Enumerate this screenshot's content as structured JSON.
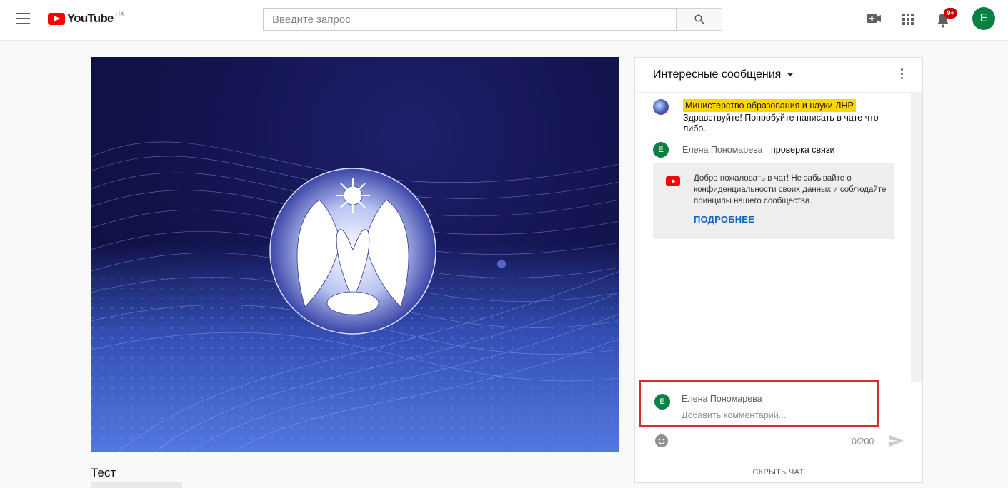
{
  "header": {
    "logo_text": "YouTube",
    "logo_region": "UA",
    "search_placeholder": "Введите запрос",
    "notifications_badge": "9+",
    "avatar_letter": "E"
  },
  "video": {
    "title": "Тест"
  },
  "chat": {
    "header_title": "Интересные сообщения",
    "pinned": {
      "author": "Министерство образования и науки ЛНР",
      "text": "Здравствуйте! Попробуйте написать в чате что либо."
    },
    "messages": [
      {
        "avatar": "E",
        "author": "Елена Пономарева",
        "text": "проверка связи"
      }
    ],
    "welcome": {
      "text": "Добро пожаловать в чат! Не забывайте о конфиденциальности своих данных и соблюдайте принципы нашего сообщества.",
      "link": "ПОДРОБНЕЕ"
    },
    "composer": {
      "avatar": "E",
      "name": "Елена Пономарева",
      "placeholder": "Добавить комментарий...",
      "char_count": "0/200"
    },
    "hide_label": "СКРЫТЬ ЧАТ"
  },
  "colors": {
    "brand_red": "#ff0000",
    "avatar_green": "#0b8043",
    "link_blue": "#1565c0",
    "highlight_yellow": "#ffd600",
    "outline_red": "#d32f2f"
  }
}
